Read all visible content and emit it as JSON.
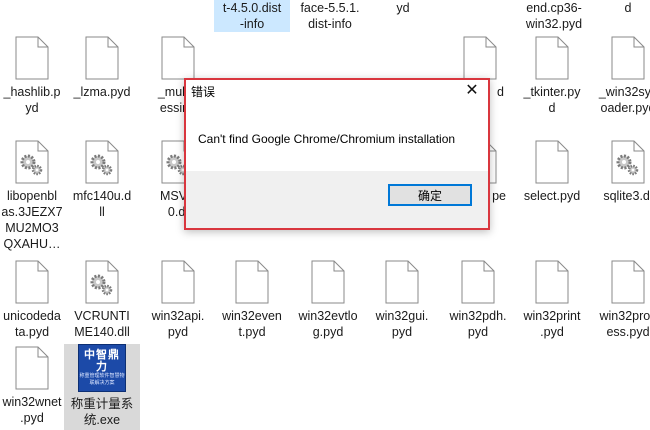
{
  "desktop": {
    "top_row": [
      {
        "label": "t-4.5.0.dist\n-info",
        "selected": true
      },
      {
        "label": "face-5.5.1.\ndist-info",
        "selected": false
      },
      {
        "label": "yd",
        "selected": false
      },
      {
        "label": "end.cp36-\nwin32.pyd",
        "selected": false
      },
      {
        "label": "d",
        "selected": false
      }
    ],
    "files": [
      {
        "label": "_hashlib.p\nyd",
        "icon": "file-icon"
      },
      {
        "label": "_lzma.pyd",
        "icon": "file-icon"
      },
      {
        "label": "_multip\nessing",
        "icon": "file-icon"
      },
      {
        "label": "d",
        "icon": "file-icon"
      },
      {
        "label": "_tkinter.py\nd",
        "icon": "file-icon"
      },
      {
        "label": "_win32sys\noader.pyd",
        "icon": "file-icon"
      },
      {
        "label": "libopenbl\nas.3JEZX7\nMU2MO3\nQXAHU…",
        "icon": "gear-file-icon"
      },
      {
        "label": "mfc140u.d\nll",
        "icon": "gear-file-icon"
      },
      {
        "label": "MSVC\n0.dl",
        "icon": "gear-file-icon"
      },
      {
        "label": "pe",
        "icon": "file-icon"
      },
      {
        "label": "select.pyd",
        "icon": "file-icon"
      },
      {
        "label": "sqlite3.dl",
        "icon": "gear-file-icon"
      },
      {
        "label": "unicodeda\nta.pyd",
        "icon": "file-icon"
      },
      {
        "label": "VCRUNTI\nME140.dll",
        "icon": "gear-file-icon"
      },
      {
        "label": "win32api.\npyd",
        "icon": "file-icon"
      },
      {
        "label": "win32even\nt.pyd",
        "icon": "file-icon"
      },
      {
        "label": "win32evtlo\ng.pyd",
        "icon": "file-icon"
      },
      {
        "label": "win32gui.\npyd",
        "icon": "file-icon"
      },
      {
        "label": "win32pdh.\npyd",
        "icon": "file-icon"
      },
      {
        "label": "win32print\n.pyd",
        "icon": "file-icon"
      },
      {
        "label": "win32proc\ness.pyd",
        "icon": "file-icon"
      },
      {
        "label": "win32wnet\n.pyd",
        "icon": "file-icon"
      },
      {
        "label": "称重计量系\n统.exe",
        "icon": "app-icon"
      }
    ],
    "app_logo_text": "中智鼎力",
    "app_logo_subtext": "称重管理软件智慧物联解决方案"
  },
  "dialog": {
    "title": "错误",
    "message": "Can't find Google Chrome/Chromium installation",
    "ok_label": "确定",
    "close_glyph": "✕",
    "border_color": "#d9363e",
    "button_border_color": "#0078d7"
  }
}
